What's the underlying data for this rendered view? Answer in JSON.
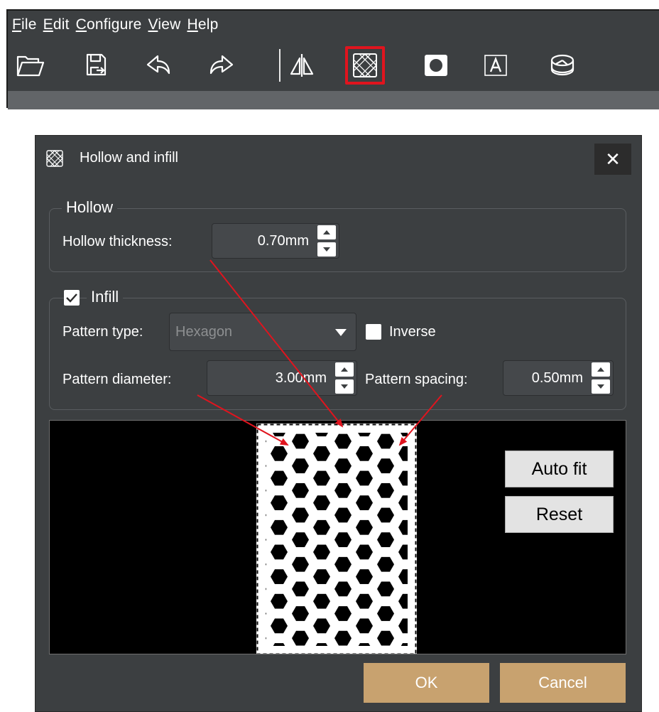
{
  "menu": {
    "items": [
      {
        "mnemonic": "F",
        "rest": "ile"
      },
      {
        "mnemonic": "E",
        "rest": "dit"
      },
      {
        "mnemonic": "C",
        "rest": "onfigure"
      },
      {
        "mnemonic": "V",
        "rest": "iew"
      },
      {
        "mnemonic": "H",
        "rest": "elp"
      }
    ]
  },
  "toolbar": {
    "icons": [
      "folder-open-icon",
      "save-icon",
      "undo-icon",
      "redo-icon",
      "mirror-icon",
      "hollow-infill-icon",
      "drain-hole-icon",
      "text-icon",
      "model-icon"
    ],
    "highlighted": "hollow-infill-icon",
    "highlight_color": "#e0141e"
  },
  "dialog": {
    "title": "Hollow and infill",
    "close_label": "✕",
    "hollow": {
      "group_title": "Hollow",
      "thickness_label": "Hollow thickness:",
      "thickness_value": "0.70mm"
    },
    "infill": {
      "group_title": "Infill",
      "enabled": true,
      "pattern_type_label": "Pattern type:",
      "pattern_type_value": "Hexagon",
      "inverse_label": "Inverse",
      "inverse_checked": false,
      "diameter_label": "Pattern diameter:",
      "diameter_value": "3.00mm",
      "spacing_label": "Pattern spacing:",
      "spacing_value": "0.50mm"
    },
    "preview": {
      "auto_fit_label": "Auto fit",
      "reset_label": "Reset"
    },
    "ok_label": "OK",
    "cancel_label": "Cancel"
  },
  "colors": {
    "panel_bg": "#3c3f41",
    "accent_button": "#c8a26f",
    "annotation_arrow": "#e0141e"
  }
}
